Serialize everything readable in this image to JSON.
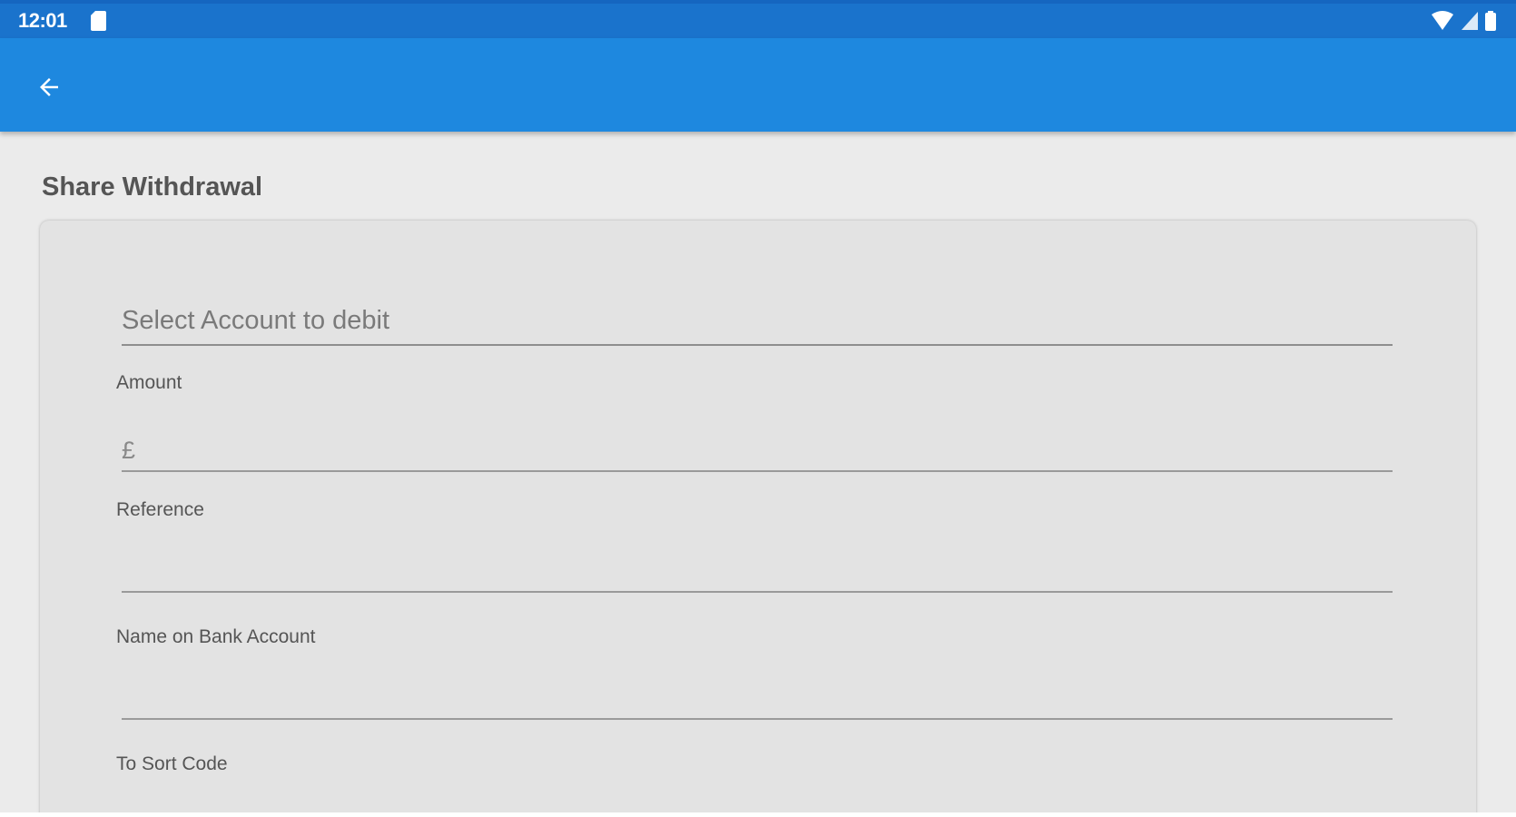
{
  "status_bar": {
    "time": "12:01",
    "icons": [
      "sd-card-icon",
      "wifi-icon",
      "cell-signal-icon",
      "battery-icon"
    ]
  },
  "app_bar": {
    "back_icon": "arrow-back-icon",
    "color": "#1e88df"
  },
  "page": {
    "title": "Share Withdrawal"
  },
  "form": {
    "account_select": {
      "placeholder": "Select Account to debit"
    },
    "amount": {
      "label": "Amount",
      "currency_symbol": "£",
      "value": ""
    },
    "reference": {
      "label": "Reference",
      "value": ""
    },
    "name_on_account": {
      "label": "Name on Bank Account",
      "value": ""
    },
    "sort_code": {
      "label": "To Sort Code"
    }
  },
  "colors": {
    "status_bar": "#1a73cc",
    "app_bar": "#1e88df",
    "background": "#ebebeb",
    "card": "#e3e3e3"
  }
}
